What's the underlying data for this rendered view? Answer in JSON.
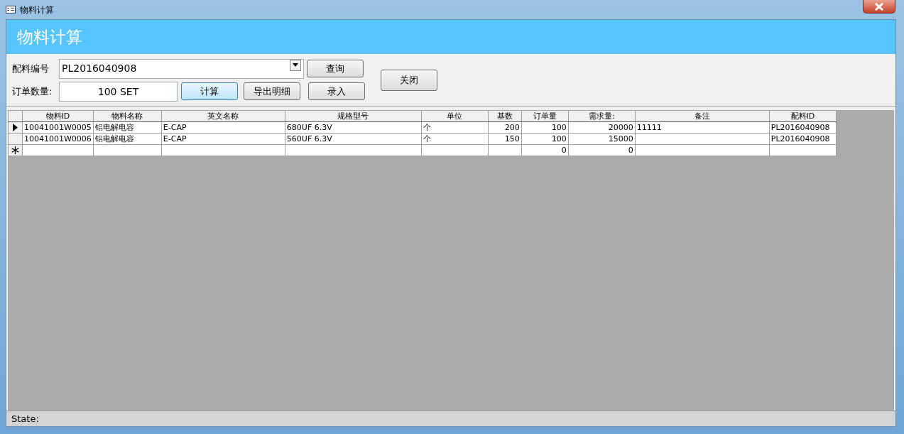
{
  "window": {
    "title": "物料计算"
  },
  "header": {
    "title": "物料计算"
  },
  "form": {
    "recipe_label": "配料编号",
    "recipe_value": "PL2016040908",
    "quantity_label": "订单数量:",
    "quantity_value": "100 SET",
    "buttons": [
      {
        "label": "查询",
        "focused": false
      },
      {
        "label": "计算",
        "focused": true
      },
      {
        "label": "导出明细",
        "focused": false
      },
      {
        "label": "录入",
        "focused": false
      },
      {
        "label": "关闭",
        "focused": false
      }
    ]
  },
  "table": {
    "columns": [
      {
        "label": "物料ID",
        "kind": "text"
      },
      {
        "label": "物料名称",
        "kind": "text"
      },
      {
        "label": "英文名称",
        "kind": "text"
      },
      {
        "label": "规格型号",
        "kind": "text"
      },
      {
        "label": "单位",
        "kind": "text"
      },
      {
        "label": "基数",
        "kind": "number"
      },
      {
        "label": "订单量",
        "kind": "number"
      },
      {
        "label": "需求量:",
        "kind": "number"
      },
      {
        "label": "备注",
        "kind": "text"
      },
      {
        "label": "配料ID",
        "kind": "text"
      }
    ],
    "rows": [
      {
        "kind": "current",
        "cells": [
          "10041001W0005",
          "铝电解电容",
          "E-CAP",
          "680UF 6.3V",
          "个",
          "200",
          "100",
          "20000",
          "11111",
          "PL2016040908"
        ]
      },
      {
        "kind": "plain",
        "cells": [
          "10041001W0006",
          "铝电解电容",
          "E-CAP",
          "560UF 6.3V",
          "个",
          "150",
          "100",
          "15000",
          "",
          "PL2016040908"
        ]
      },
      {
        "kind": "new",
        "cells": [
          "",
          "",
          "",
          "",
          "",
          "",
          "0",
          "0",
          "",
          ""
        ]
      }
    ]
  },
  "status_bar": {
    "text": "State:"
  }
}
